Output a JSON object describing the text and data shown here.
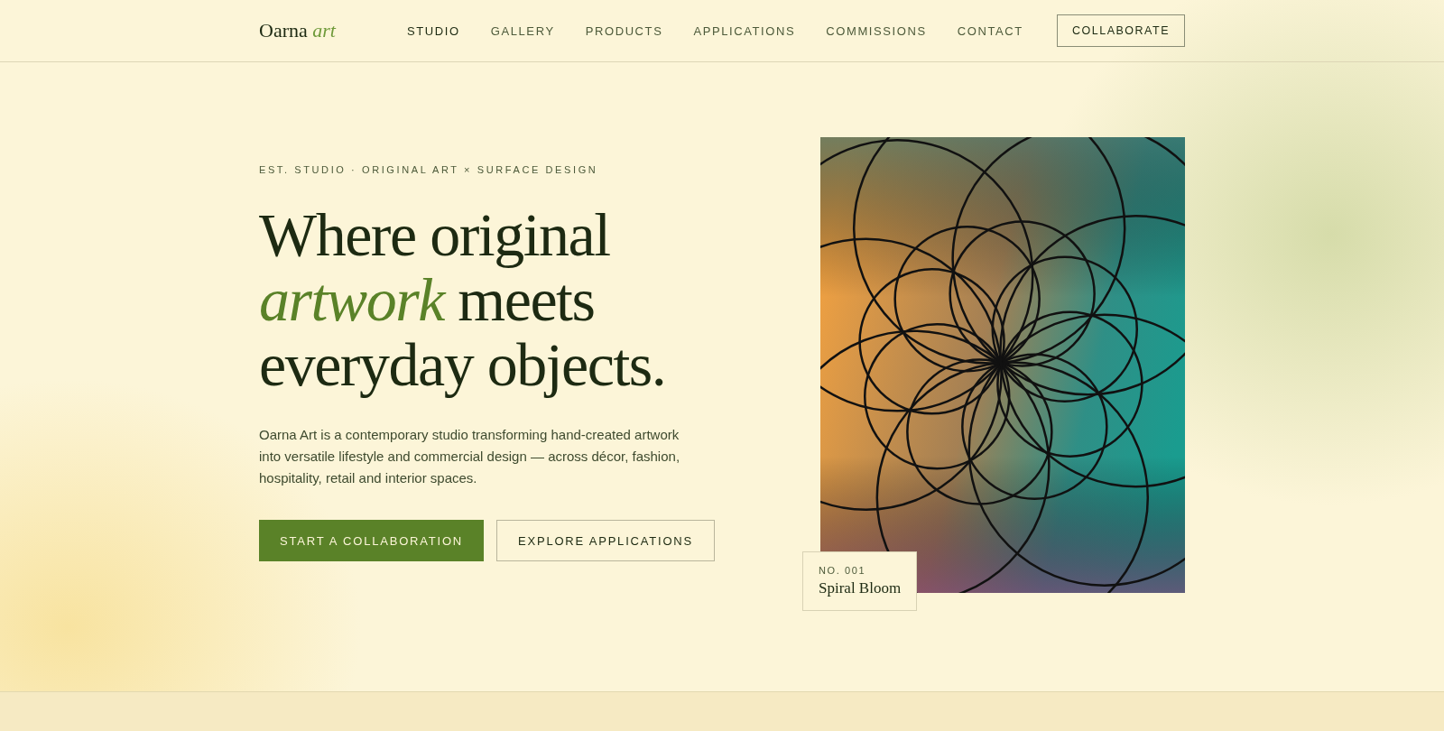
{
  "brand": "Oarna *art*",
  "nav": [
    {
      "label": "STUDIO",
      "selected": true
    },
    {
      "label": "GALLERY",
      "selected": false
    },
    {
      "label": "PRODUCTS",
      "selected": false
    },
    {
      "label": "APPLICATIONS",
      "selected": false
    },
    {
      "label": "COMMISSIONS",
      "selected": false
    },
    {
      "label": "CONTACT",
      "selected": false
    }
  ],
  "cta": "COLLABORATE",
  "hero": {
    "eyebrow": "EST. STUDIO · ORIGINAL ART × SURFACE DESIGN",
    "heading": "Where original *artwork* meets everyday objects.",
    "body": "Oarna Art is a contemporary studio transforming hand-created artwork into versatile lifestyle and commercial design — across décor, fashion, hospitality, retail and interior spaces.",
    "buttons": [
      {
        "label": "START A COLLABORATION",
        "kind": "primary"
      },
      {
        "label": "EXPLORE APPLICATIONS",
        "kind": "outline"
      }
    ]
  },
  "artwork": {
    "number": "NO. 001",
    "title": "Spiral Bloom"
  }
}
